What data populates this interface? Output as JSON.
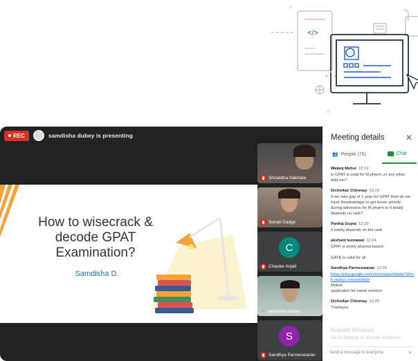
{
  "decoration": {
    "code_glyph": "</>"
  },
  "meeting": {
    "rec_label": "REC",
    "presenting_text": "samdisha dubey is presenting"
  },
  "slide": {
    "title_line1": "How to wisecrack &",
    "title_line2": "decode GPAT",
    "title_line3": "Examination?",
    "author": "Samdisha D."
  },
  "tiles": [
    {
      "name": "Shraddha Nakhate",
      "kind": "video"
    },
    {
      "name": "Sonali Gadge",
      "kind": "video"
    },
    {
      "name": "Chaube Anjali",
      "kind": "avatar",
      "initial": "C",
      "color": "#00897b"
    },
    {
      "name": "samdisha dubey",
      "kind": "video"
    },
    {
      "name": "Sandhya Parmeswaran",
      "kind": "avatar",
      "initial": "S",
      "color": "#8e24aa"
    }
  ],
  "panel": {
    "title": "Meeting details",
    "close_icon": "close-icon",
    "tab_people": "People (75)",
    "tab_chat": "Chat",
    "messages": [
      {
        "author": "Walanj Mehul",
        "time": "12:19",
        "lines": [
          "Is GPAT is valid for M.pharm ,or any other",
          "feild too?"
        ]
      },
      {
        "author": "Dicholkar Chinmay",
        "time": "12:23",
        "lines": [
          "If we take gap of 1 year for GPAT then do we",
          "have disadvantage or get lesser priority",
          "during  admission for M pharm or it totally",
          "depends on rank?"
        ]
      },
      {
        "author": "Pankaj Gupta",
        "time": "12:23",
        "lines": [
          "It totally depends on the rank"
        ]
      },
      {
        "author": "akshant kumawat",
        "time": "12:24",
        "lines": [
          "GPAT is solely pharma based",
          "",
          "GATE is valid for all"
        ]
      },
      {
        "author": "Sandhya Parmeswaran",
        "time": "12:26",
        "link": "https://play.google.com/store/apps/details?id=ch.reaxys.reactionflash",
        "lines": [
          "Mobile",
          "application for name reaction"
        ]
      },
      {
        "author": "Dicholkar Chinmay",
        "time": "12:26",
        "lines": [
          "Thankyou"
        ]
      }
    ],
    "watermark_line1": "Activate Windows",
    "watermark_line2": "Go to Settings to activate Windows.",
    "input_placeholder": "Send a message to everyone"
  }
}
